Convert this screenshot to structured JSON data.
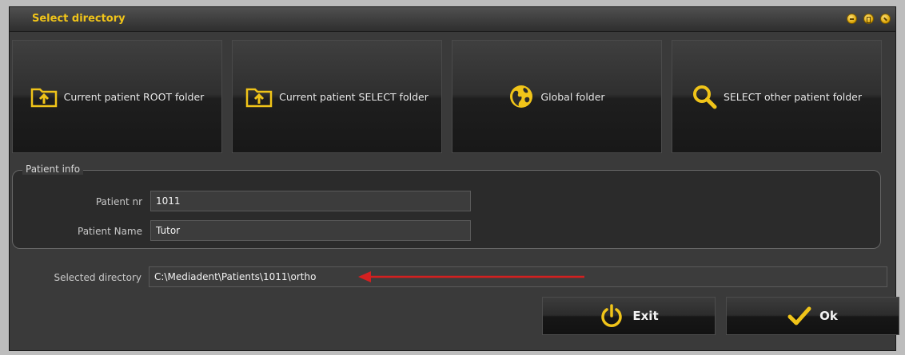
{
  "window": {
    "title": "Select directory"
  },
  "tiles": [
    {
      "label": "Current patient ROOT folder",
      "icon": "folder-upload-icon"
    },
    {
      "label": "Current patient SELECT folder",
      "icon": "folder-upload-icon"
    },
    {
      "label": "Global folder",
      "icon": "globe-icon"
    },
    {
      "label": "SELECT other patient folder",
      "icon": "magnifier-icon"
    }
  ],
  "patient_info": {
    "group_title": "Patient info",
    "nr_label": "Patient nr",
    "nr_value": "1011",
    "name_label": "Patient Name",
    "name_value": "Tutor"
  },
  "selected_directory": {
    "label": "Selected directory",
    "value": "C:\\Mediadent\\Patients\\1011\\ortho"
  },
  "buttons": {
    "exit_label": "Exit",
    "ok_label": "Ok"
  },
  "colors": {
    "accent": "#f0c419",
    "arrow": "#d32020",
    "window_bg": "#3a3a3a"
  }
}
